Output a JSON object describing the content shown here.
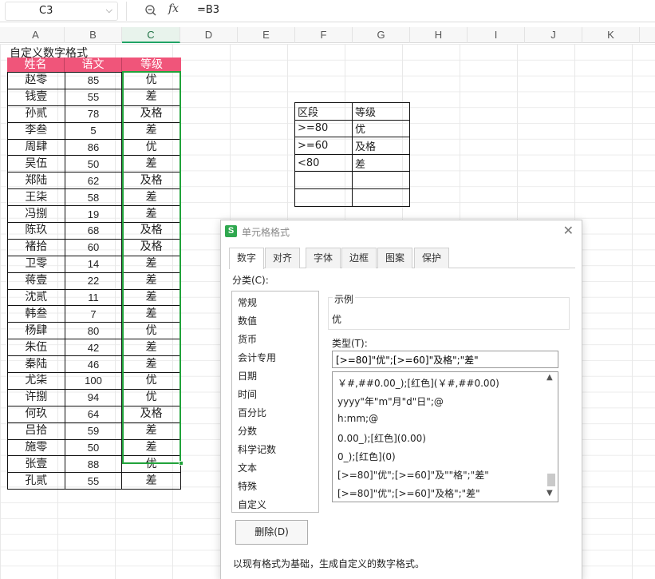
{
  "formula_bar": {
    "name_box": "C3",
    "formula": "=B3"
  },
  "columns": [
    "A",
    "B",
    "C",
    "D",
    "E",
    "F",
    "G",
    "H",
    "I",
    "J",
    "K"
  ],
  "sheet": {
    "title": "自定义数字格式",
    "headers": [
      "姓名",
      "语文",
      "等级"
    ],
    "rows": [
      [
        "赵零",
        "85",
        "优"
      ],
      [
        "钱壹",
        "55",
        "差"
      ],
      [
        "孙贰",
        "78",
        "及格"
      ],
      [
        "李叁",
        "5",
        "差"
      ],
      [
        "周肆",
        "86",
        "优"
      ],
      [
        "吴伍",
        "50",
        "差"
      ],
      [
        "郑陆",
        "62",
        "及格"
      ],
      [
        "王柒",
        "58",
        "差"
      ],
      [
        "冯捌",
        "19",
        "差"
      ],
      [
        "陈玖",
        "68",
        "及格"
      ],
      [
        "褚拾",
        "60",
        "及格"
      ],
      [
        "卫零",
        "14",
        "差"
      ],
      [
        "蒋壹",
        "22",
        "差"
      ],
      [
        "沈贰",
        "11",
        "差"
      ],
      [
        "韩叁",
        "7",
        "差"
      ],
      [
        "杨肆",
        "80",
        "优"
      ],
      [
        "朱伍",
        "42",
        "差"
      ],
      [
        "秦陆",
        "46",
        "差"
      ],
      [
        "尤柒",
        "100",
        "优"
      ],
      [
        "许捌",
        "94",
        "优"
      ],
      [
        "何玖",
        "64",
        "及格"
      ],
      [
        "吕拾",
        "59",
        "差"
      ],
      [
        "施零",
        "50",
        "差"
      ],
      [
        "张壹",
        "88",
        "优"
      ],
      [
        "孔贰",
        "55",
        "差"
      ]
    ],
    "level_table": [
      [
        "区段",
        "等级"
      ],
      [
        ">=80",
        "优"
      ],
      [
        ">=60",
        "及格"
      ],
      [
        "<80",
        "差"
      ],
      [
        "",
        ""
      ],
      [
        "",
        ""
      ]
    ]
  },
  "dialog": {
    "title": "单元格格式",
    "tabs": [
      "数字",
      "对齐",
      "字体",
      "边框",
      "图案",
      "保护"
    ],
    "category_label": "分类(C):",
    "categories": [
      "常规",
      "数值",
      "货币",
      "会计专用",
      "日期",
      "时间",
      "百分比",
      "分数",
      "科学记数",
      "文本",
      "特殊",
      "自定义"
    ],
    "preview_label": "示例",
    "preview_value": "优",
    "type_label": "类型(T):",
    "type_value": "[>=80]\"优\";[>=60]\"及格\";\"差\"",
    "formats": [
      "￥#,##0.00_);[红色](￥#,##0.00)",
      "yyyy\"年\"m\"月\"d\"日\";@",
      "h:mm;@",
      "0.00_);[红色](0.00)",
      "0_);[红色](0)",
      "[>=80]\"优\";[>=60]\"及\"\"格\";\"差\"",
      "[>=80]\"优\";[>=60]\"及格\";\"差\""
    ],
    "delete_label": "删除(D)",
    "hint": "以现有格式为基础，生成自定义的数字格式。"
  }
}
